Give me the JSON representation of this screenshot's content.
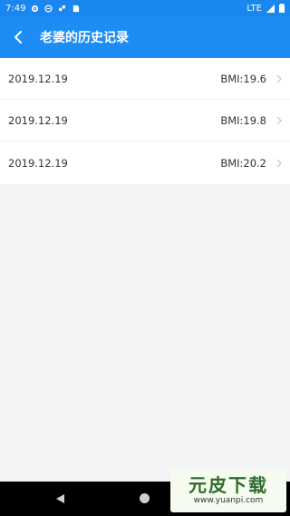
{
  "status_bar": {
    "time": "7:49",
    "network": "LTE"
  },
  "app_bar": {
    "title": "老婆的历史记录"
  },
  "records": [
    {
      "date": "2019.12.19",
      "bmi": "BMI:19.6"
    },
    {
      "date": "2019.12.19",
      "bmi": "BMI:19.8"
    },
    {
      "date": "2019.12.19",
      "bmi": "BMI:20.2"
    }
  ],
  "watermark": {
    "logo": "元皮下载",
    "url": "www.yuanpi.com"
  },
  "colors": {
    "primary": "#1e8cf5",
    "status_bar": "#1a86f0",
    "background": "#f4f4f6"
  }
}
